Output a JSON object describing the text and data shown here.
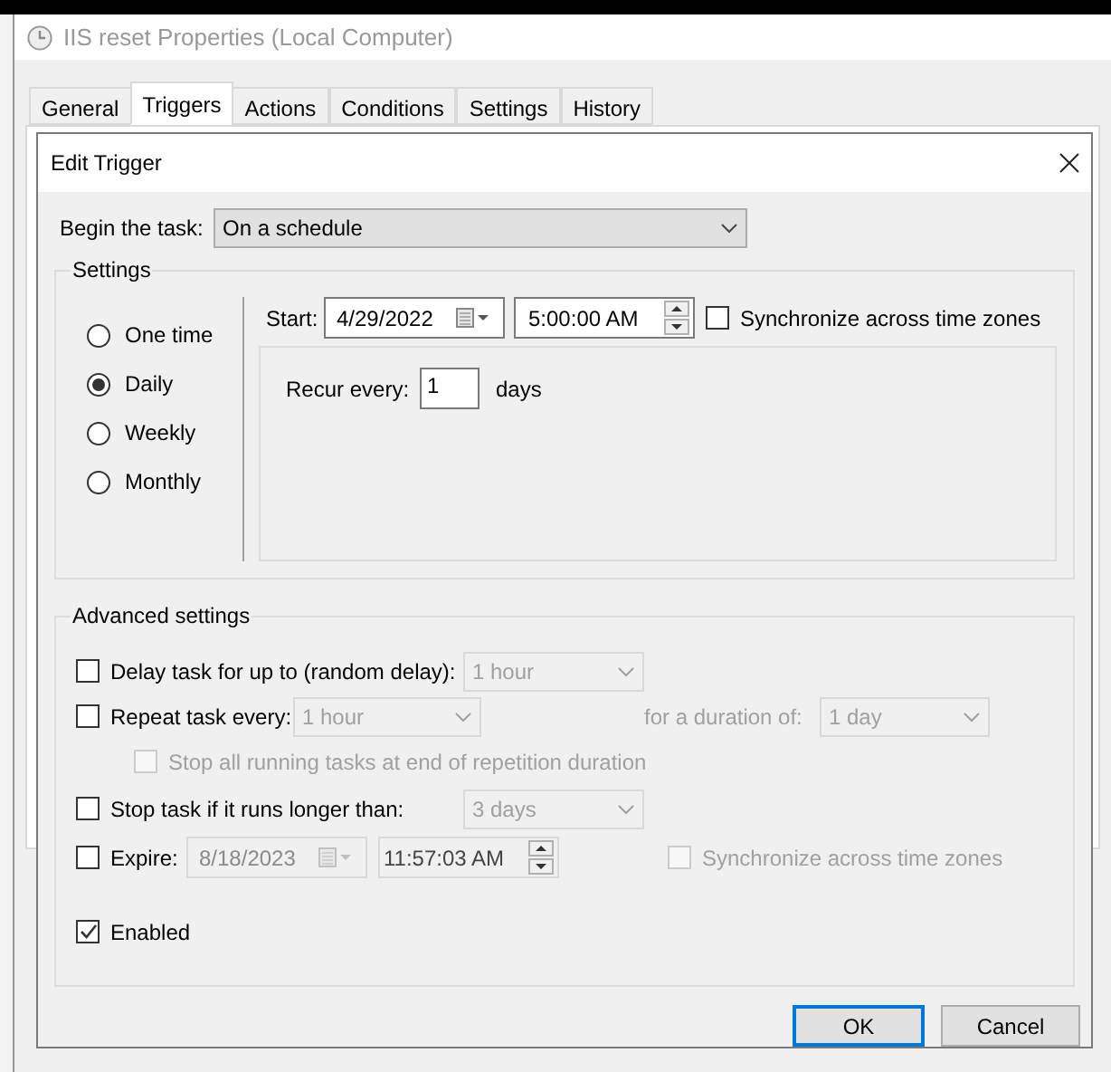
{
  "window": {
    "title": "IIS reset Properties (Local Computer)"
  },
  "tabs": [
    {
      "label": "General",
      "selected": false
    },
    {
      "label": "Triggers",
      "selected": true
    },
    {
      "label": "Actions",
      "selected": false
    },
    {
      "label": "Conditions",
      "selected": false
    },
    {
      "label": "Settings",
      "selected": false
    },
    {
      "label": "History",
      "selected": false
    }
  ],
  "dialog": {
    "title": "Edit Trigger",
    "begin_task": {
      "label": "Begin the task:",
      "value": "On a schedule"
    },
    "settings": {
      "title": "Settings",
      "schedule_options": [
        {
          "label": "One time",
          "selected": false
        },
        {
          "label": "Daily",
          "selected": true
        },
        {
          "label": "Weekly",
          "selected": false
        },
        {
          "label": "Monthly",
          "selected": false
        }
      ],
      "start": {
        "label": "Start:",
        "date": "4/29/2022",
        "time": "5:00:00 AM",
        "sync": {
          "label": "Synchronize across time zones",
          "checked": false
        }
      },
      "recur": {
        "label": "Recur every:",
        "value": "1",
        "unit": "days"
      }
    },
    "advanced": {
      "title": "Advanced settings",
      "delay": {
        "label": "Delay task for up to (random delay):",
        "checked": false,
        "value": "1 hour",
        "disabled": true
      },
      "repeat": {
        "label": "Repeat task every:",
        "checked": false,
        "value": "1 hour",
        "disabled": true,
        "duration_label": "for a duration of:",
        "duration_value": "1 day",
        "stop_all": {
          "label": "Stop all running tasks at end of repetition duration",
          "checked": false,
          "disabled": true
        }
      },
      "stop_if_longer": {
        "label": "Stop task if it runs longer than:",
        "checked": false,
        "value": "3 days",
        "disabled": true
      },
      "expire": {
        "label": "Expire:",
        "checked": false,
        "date": "8/18/2023",
        "time": "11:57:03 AM",
        "disabled": true,
        "sync": {
          "label": "Synchronize across time zones",
          "checked": false,
          "disabled": true
        }
      },
      "enabled": {
        "label": "Enabled",
        "checked": true
      }
    },
    "buttons": [
      {
        "label": "OK",
        "default": true
      },
      {
        "label": "Cancel",
        "default": false
      }
    ]
  }
}
